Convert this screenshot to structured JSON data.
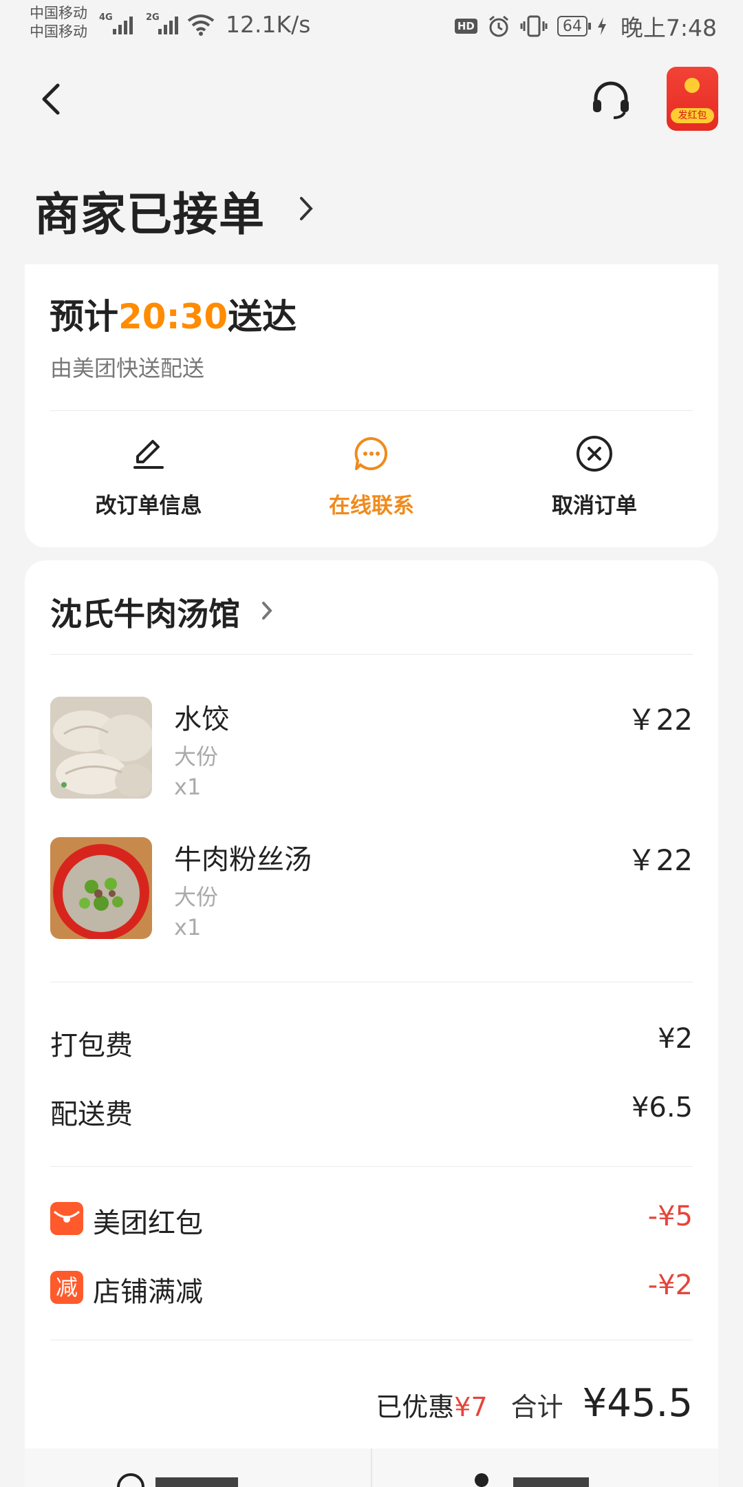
{
  "status_bar": {
    "carrier_1": "中国移动",
    "carrier_2": "中国移动",
    "net_1": "4G",
    "net_2": "2G",
    "speed": "12.1K/s",
    "hd": "HD",
    "battery": "64",
    "time": "晚上7:48"
  },
  "nav": {
    "red_packet_label": "发红包"
  },
  "order_status": "商家已接单",
  "delivery": {
    "eta_prefix": "预计",
    "eta_time": "20:30",
    "eta_suffix": "送达",
    "courier": "由美团快送配送",
    "actions": [
      {
        "label": "改订单信息",
        "icon": "edit-icon"
      },
      {
        "label": "在线联系",
        "icon": "chat-icon"
      },
      {
        "label": "取消订单",
        "icon": "cancel-circle-icon"
      }
    ]
  },
  "order": {
    "shop_name": "沈氏牛肉汤馆",
    "items": [
      {
        "name": "水饺",
        "spec": "大份",
        "qty": "x1",
        "price": "￥22"
      },
      {
        "name": "牛肉粉丝汤",
        "spec": "大份",
        "qty": "x1",
        "price": "￥22"
      }
    ],
    "fees": [
      {
        "label": "打包费",
        "value": "¥2"
      },
      {
        "label": "配送费",
        "value": "¥6.5"
      }
    ],
    "discounts": [
      {
        "label": "美团红包",
        "value": "-¥5",
        "icon": "red-packet-icon"
      },
      {
        "label": "店铺满减",
        "value": "-¥2",
        "icon_text": "减"
      }
    ],
    "saved_label": "已优惠",
    "saved_value": "¥7",
    "sum_label": "合计",
    "sum_value": "¥45.5"
  },
  "colors": {
    "accent_orange": "#ff8c00",
    "discount_red": "#e5443b",
    "red_packet": "#f24236"
  }
}
